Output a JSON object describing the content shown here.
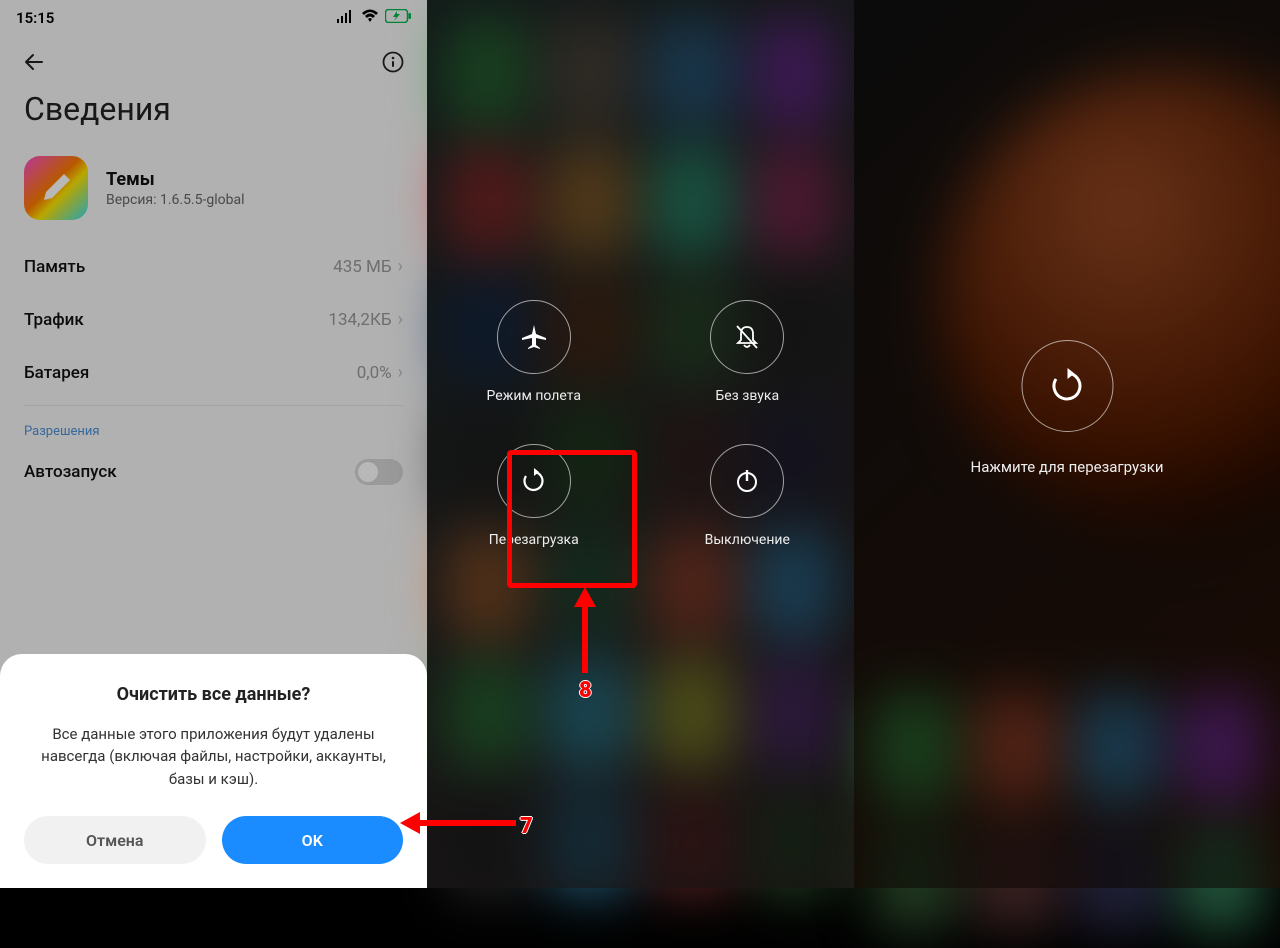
{
  "panel1": {
    "status": {
      "time": "15:15"
    },
    "title": "Сведения",
    "app": {
      "name": "Темы",
      "version": "Версия: 1.6.5.5-global"
    },
    "rows": {
      "memory": {
        "label": "Память",
        "value": "435 МБ"
      },
      "traffic": {
        "label": "Трафик",
        "value": "134,2КБ"
      },
      "battery": {
        "label": "Батарея",
        "value": "0,0%"
      }
    },
    "section_permissions": "Разрешения",
    "autostart": {
      "label": "Автозапуск"
    },
    "dialog": {
      "title": "Очистить все данные?",
      "body": "Все данные этого приложения будут удалены навсегда (включая файлы, настройки, аккаунты, базы и кэш).",
      "cancel": "Отмена",
      "ok": "OK"
    }
  },
  "panel2": {
    "items": {
      "airplane": "Режим полета",
      "silent": "Без звука",
      "reboot": "Перезагрузка",
      "shutdown": "Выключение"
    }
  },
  "panel3": {
    "label": "Нажмите для перезагрузки"
  },
  "annotations": {
    "n7": "7",
    "n8": "8"
  },
  "colors": {
    "accent": "#1a8cff",
    "highlight": "#ff0000"
  }
}
